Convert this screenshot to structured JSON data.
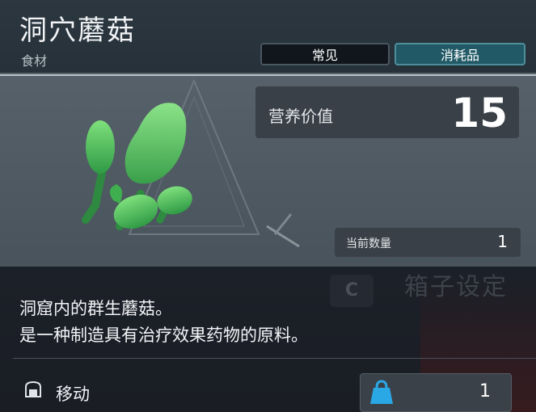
{
  "item": {
    "name": "洞穴蘑菇",
    "category": "食材",
    "tags": [
      "常见",
      "消耗品"
    ]
  },
  "stats": {
    "nutrition_label": "营养价值",
    "nutrition_value": "15",
    "quantity_label": "当前数量",
    "quantity_value": "1"
  },
  "description": [
    "洞窟内的群生蘑菇。",
    "是一种制造具有治疗效果药物的原料。"
  ],
  "background": {
    "key_hint": "C",
    "hint_text": "箱子设定"
  },
  "action": {
    "icon": "move-icon",
    "label": "移动",
    "bag_icon": "bag-icon",
    "value": "1"
  },
  "colors": {
    "accent_teal": "#215a66",
    "mushroom_green": "#4fbf55",
    "bag_blue": "#2aa8e6"
  }
}
